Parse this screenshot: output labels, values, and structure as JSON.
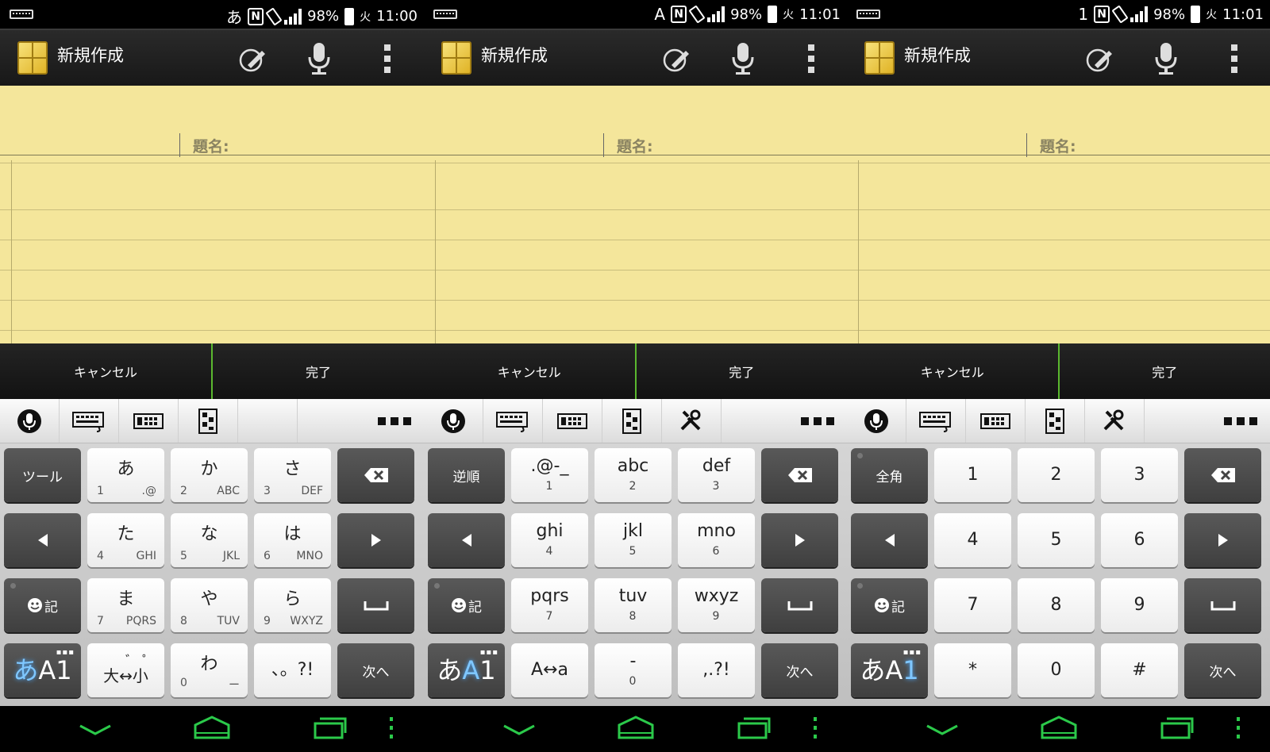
{
  "panels": [
    {
      "status": {
        "ime_mode": "あ",
        "battery": "98%",
        "time": "11:00",
        "alarm": "火"
      },
      "app_title": "新規作成",
      "title_label": "題名:",
      "cancel_label": "キャンセル",
      "done_label": "完了",
      "keys": [
        {
          "id": "tool",
          "type": "dark",
          "label": "ツール"
        },
        {
          "id": "a",
          "type": "light",
          "main": "あ",
          "sub_left": "1",
          "sub_right": ".@"
        },
        {
          "id": "ka",
          "type": "light",
          "main": "か",
          "sub_left": "2",
          "sub_right": "ABC"
        },
        {
          "id": "sa",
          "type": "light",
          "main": "さ",
          "sub_left": "3",
          "sub_right": "DEF"
        },
        {
          "id": "bs",
          "type": "dark",
          "icon": "backspace"
        },
        {
          "id": "left",
          "type": "dark",
          "icon": "left"
        },
        {
          "id": "ta",
          "type": "light",
          "main": "た",
          "sub_left": "4",
          "sub_right": "GHI"
        },
        {
          "id": "na",
          "type": "light",
          "main": "な",
          "sub_left": "5",
          "sub_right": "JKL"
        },
        {
          "id": "ha",
          "type": "light",
          "main": "は",
          "sub_left": "6",
          "sub_right": "MNO"
        },
        {
          "id": "right",
          "type": "dark",
          "icon": "right"
        },
        {
          "id": "emoji",
          "type": "dark",
          "label": "記",
          "icon": "smiley"
        },
        {
          "id": "ma",
          "type": "light",
          "main": "ま",
          "sub_left": "7",
          "sub_right": "PQRS"
        },
        {
          "id": "ya",
          "type": "light",
          "main": "や",
          "sub_left": "8",
          "sub_right": "TUV"
        },
        {
          "id": "ra",
          "type": "light",
          "main": "ら",
          "sub_left": "9",
          "sub_right": "WXYZ"
        },
        {
          "id": "space",
          "type": "dark",
          "icon": "space"
        },
        {
          "id": "mode",
          "type": "mode",
          "a": "あ",
          "b": "A",
          "c": "1",
          "hl": "a"
        },
        {
          "id": "daku",
          "type": "light",
          "main": "大↔小",
          "top": "゛ ゜"
        },
        {
          "id": "wa",
          "type": "light",
          "main": "わ",
          "sub_left": "0",
          "sub_right": "ー"
        },
        {
          "id": "punct",
          "type": "light",
          "main": "、。?!"
        },
        {
          "id": "next",
          "type": "dark",
          "label": "次へ"
        }
      ]
    },
    {
      "status": {
        "ime_mode": "A",
        "battery": "98%",
        "time": "11:01",
        "alarm": "火"
      },
      "app_title": "新規作成",
      "title_label": "題名:",
      "cancel_label": "キャンセル",
      "done_label": "完了",
      "keys": [
        {
          "id": "reverse",
          "type": "dark",
          "label": "逆順"
        },
        {
          "id": "sym",
          "type": "light",
          "main": ".@-_",
          "sub": "1"
        },
        {
          "id": "abc",
          "type": "light",
          "main": "abc",
          "sub": "2"
        },
        {
          "id": "def",
          "type": "light",
          "main": "def",
          "sub": "3"
        },
        {
          "id": "bs",
          "type": "dark",
          "icon": "backspace"
        },
        {
          "id": "left",
          "type": "dark",
          "icon": "left"
        },
        {
          "id": "ghi",
          "type": "light",
          "main": "ghi",
          "sub": "4"
        },
        {
          "id": "jkl",
          "type": "light",
          "main": "jkl",
          "sub": "5"
        },
        {
          "id": "mno",
          "type": "light",
          "main": "mno",
          "sub": "6"
        },
        {
          "id": "right",
          "type": "dark",
          "icon": "right"
        },
        {
          "id": "emoji",
          "type": "dark",
          "label": "記",
          "icon": "smiley"
        },
        {
          "id": "pqrs",
          "type": "light",
          "main": "pqrs",
          "sub": "7"
        },
        {
          "id": "tuv",
          "type": "light",
          "main": "tuv",
          "sub": "8"
        },
        {
          "id": "wxyz",
          "type": "light",
          "main": "wxyz",
          "sub": "9"
        },
        {
          "id": "space",
          "type": "dark",
          "icon": "space"
        },
        {
          "id": "mode",
          "type": "mode",
          "a": "あ",
          "b": "A",
          "c": "1",
          "hl": "b"
        },
        {
          "id": "case",
          "type": "light",
          "main": "A↔a"
        },
        {
          "id": "dash",
          "type": "light",
          "main": "-",
          "sub": "0"
        },
        {
          "id": "punct",
          "type": "light",
          "main": ",.?!"
        },
        {
          "id": "next",
          "type": "dark",
          "label": "次へ"
        }
      ]
    },
    {
      "status": {
        "ime_mode": "1",
        "battery": "98%",
        "time": "11:01",
        "alarm": "火"
      },
      "app_title": "新規作成",
      "title_label": "題名:",
      "cancel_label": "キャンセル",
      "done_label": "完了",
      "keys": [
        {
          "id": "fullwidth",
          "type": "dark",
          "label": "全角"
        },
        {
          "id": "n1",
          "type": "light",
          "main": "1"
        },
        {
          "id": "n2",
          "type": "light",
          "main": "2"
        },
        {
          "id": "n3",
          "type": "light",
          "main": "3"
        },
        {
          "id": "bs",
          "type": "dark",
          "icon": "backspace"
        },
        {
          "id": "left",
          "type": "dark",
          "icon": "left"
        },
        {
          "id": "n4",
          "type": "light",
          "main": "4"
        },
        {
          "id": "n5",
          "type": "light",
          "main": "5"
        },
        {
          "id": "n6",
          "type": "light",
          "main": "6"
        },
        {
          "id": "right",
          "type": "dark",
          "icon": "right"
        },
        {
          "id": "emoji",
          "type": "dark",
          "label": "記",
          "icon": "smiley"
        },
        {
          "id": "n7",
          "type": "light",
          "main": "7"
        },
        {
          "id": "n8",
          "type": "light",
          "main": "8"
        },
        {
          "id": "n9",
          "type": "light",
          "main": "9"
        },
        {
          "id": "space",
          "type": "dark",
          "icon": "space"
        },
        {
          "id": "mode",
          "type": "mode",
          "a": "あ",
          "b": "A",
          "c": "1",
          "hl": "c"
        },
        {
          "id": "star",
          "type": "light",
          "main": "*"
        },
        {
          "id": "n0",
          "type": "light",
          "main": "0"
        },
        {
          "id": "hash",
          "type": "light",
          "main": "#"
        },
        {
          "id": "next",
          "type": "dark",
          "label": "次へ"
        }
      ]
    }
  ],
  "toolbars": [
    [
      "mic-icon",
      "keyboard-icon",
      "keyboard-layout-icon",
      "flick-layout-icon",
      "",
      "more-icon"
    ],
    [
      "mic-icon",
      "keyboard-icon",
      "keyboard-layout-icon",
      "flick-layout-icon",
      "tools-icon",
      "more-icon"
    ],
    [
      "mic-icon",
      "keyboard-icon",
      "keyboard-layout-icon",
      "flick-layout-icon",
      "tools-icon",
      "more-icon"
    ]
  ],
  "colors": {
    "accent_green": "#5bb82f",
    "paper": "#f4e69b",
    "nav_green": "#2bc94a",
    "highlight": "#7fc7ff"
  }
}
